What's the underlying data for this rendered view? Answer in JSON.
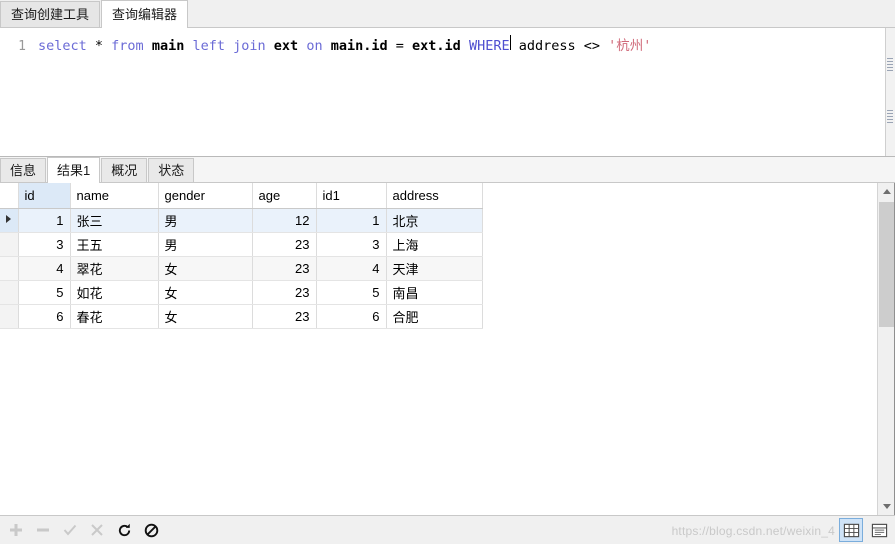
{
  "window": {
    "top_tabs": [
      {
        "label": "查询创建工具",
        "active": false
      },
      {
        "label": "查询编辑器",
        "active": true
      }
    ]
  },
  "editor": {
    "line_number": "1",
    "sql_tokens": [
      {
        "text": "select",
        "type": "keyword"
      },
      {
        "text": " * ",
        "type": "plain"
      },
      {
        "text": "from",
        "type": "keyword"
      },
      {
        "text": " ",
        "type": "plain"
      },
      {
        "text": "main",
        "type": "identifier"
      },
      {
        "text": " ",
        "type": "plain"
      },
      {
        "text": "left",
        "type": "keyword"
      },
      {
        "text": " ",
        "type": "plain"
      },
      {
        "text": "join",
        "type": "keyword"
      },
      {
        "text": " ",
        "type": "plain"
      },
      {
        "text": "ext",
        "type": "identifier"
      },
      {
        "text": " ",
        "type": "plain"
      },
      {
        "text": "on",
        "type": "keyword"
      },
      {
        "text": " ",
        "type": "plain"
      },
      {
        "text": "main.id",
        "type": "identifier"
      },
      {
        "text": " = ",
        "type": "plain"
      },
      {
        "text": "ext.id",
        "type": "identifier"
      },
      {
        "text": " ",
        "type": "plain"
      },
      {
        "text": "WHERE",
        "type": "keyword2"
      },
      {
        "text": " address <> ",
        "type": "plain"
      },
      {
        "text": "'杭州'",
        "type": "string"
      }
    ],
    "sql_text": "select * from main left join ext on main.id = ext.id WHERE address <> '杭州'"
  },
  "result_tabs": [
    {
      "label": "信息",
      "active": false
    },
    {
      "label": "结果1",
      "active": true
    },
    {
      "label": "概况",
      "active": false
    },
    {
      "label": "状态",
      "active": false
    }
  ],
  "grid": {
    "columns": [
      {
        "key": "id",
        "label": "id",
        "align": "num",
        "highlight": true
      },
      {
        "key": "name",
        "label": "name",
        "align": "txt",
        "highlight": false
      },
      {
        "key": "gender",
        "label": "gender",
        "align": "txt",
        "highlight": false
      },
      {
        "key": "age",
        "label": "age",
        "align": "num",
        "highlight": false
      },
      {
        "key": "id1",
        "label": "id1",
        "align": "num",
        "highlight": false
      },
      {
        "key": "address",
        "label": "address",
        "align": "txt",
        "highlight": false
      }
    ],
    "rows": [
      {
        "id": "1",
        "name": "张三",
        "gender": "男",
        "age": "12",
        "id1": "1",
        "address": "北京",
        "selected": true
      },
      {
        "id": "3",
        "name": "王五",
        "gender": "男",
        "age": "23",
        "id1": "3",
        "address": "上海",
        "selected": false
      },
      {
        "id": "4",
        "name": "翠花",
        "gender": "女",
        "age": "23",
        "id1": "4",
        "address": "天津",
        "selected": false
      },
      {
        "id": "5",
        "name": "如花",
        "gender": "女",
        "age": "23",
        "id1": "5",
        "address": "南昌",
        "selected": false
      },
      {
        "id": "6",
        "name": "春花",
        "gender": "女",
        "age": "23",
        "id1": "6",
        "address": "合肥",
        "selected": false
      }
    ],
    "row_count": 5
  },
  "bottom_toolbar": {
    "buttons": [
      {
        "icon": "plus-icon",
        "enabled": false
      },
      {
        "icon": "minus-icon",
        "enabled": false
      },
      {
        "icon": "check-icon",
        "enabled": false
      },
      {
        "icon": "cross-icon",
        "enabled": false
      },
      {
        "icon": "refresh-icon",
        "enabled": true
      },
      {
        "icon": "stop-icon",
        "enabled": true
      }
    ],
    "view_modes": [
      {
        "icon": "grid-view-icon",
        "active": true
      },
      {
        "icon": "form-view-icon",
        "active": false
      }
    ]
  },
  "watermark": "https://blog.csdn.net/weixin_4",
  "colors": {
    "keyword": "#6b6bd6",
    "string": "#d06a7a",
    "selection": "#dce9f7",
    "accent": "#7aaddc"
  }
}
